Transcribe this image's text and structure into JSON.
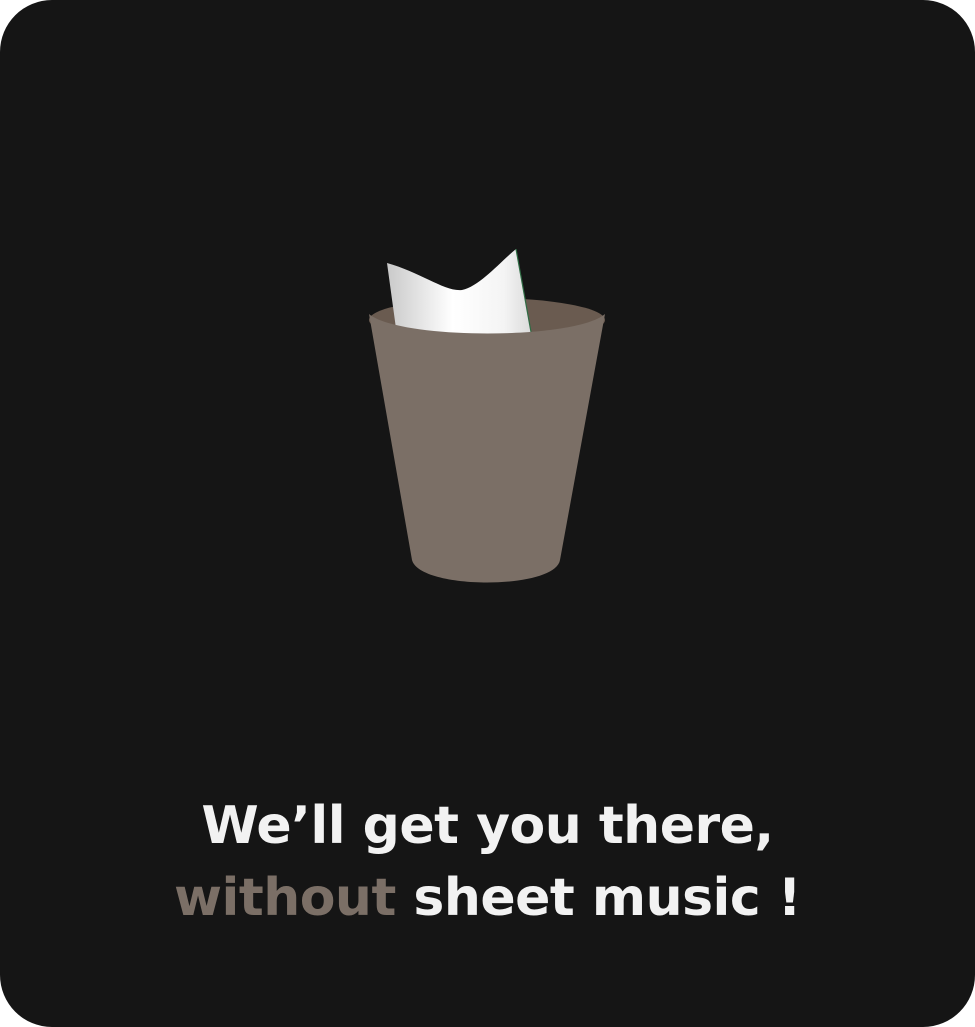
{
  "headline": {
    "line1": "We’ll get you there,",
    "line2_accent": "without",
    "line2_rest": " sheet music !"
  },
  "illustration": {
    "icon": "trash-bin-with-sheet-music-icon"
  },
  "colors": {
    "background": "#151515",
    "bin": "#7b6f66",
    "bin_inner": "#6a5b50",
    "paper": "#f0f0f0",
    "text": "#f2f2f2",
    "accent": "#7b6f66"
  }
}
